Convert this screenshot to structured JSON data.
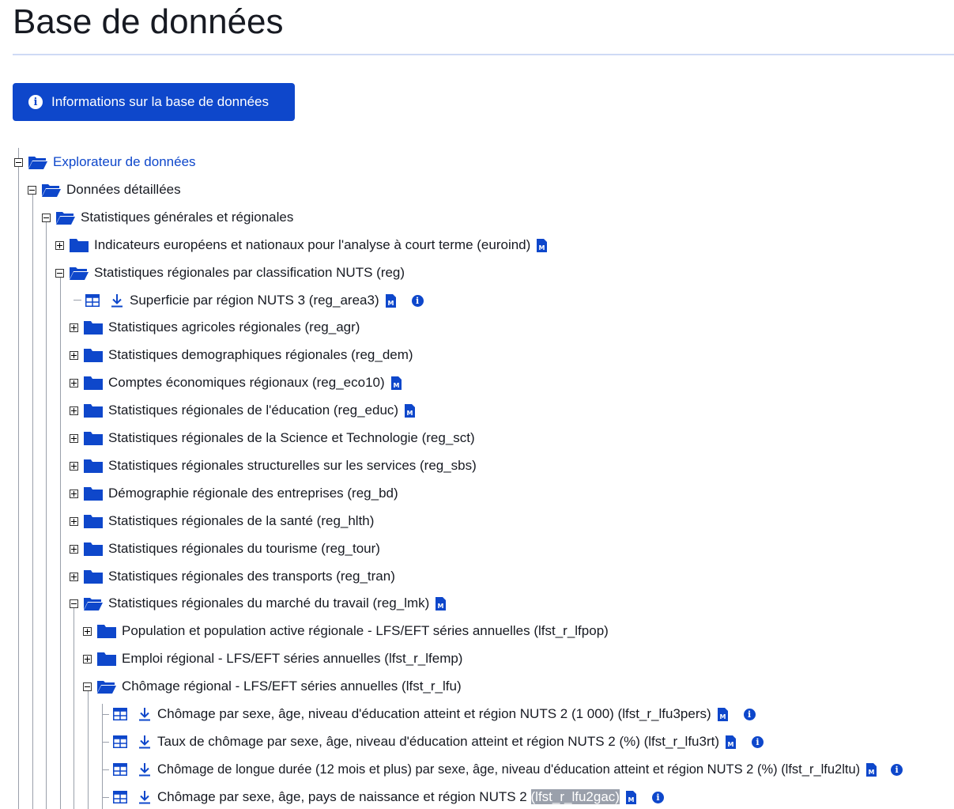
{
  "page": {
    "title": "Base de données"
  },
  "info_button": {
    "label": "Informations sur la base de données",
    "icon": "info-circle-icon"
  },
  "tree": {
    "root": "Explorateur de données",
    "detailed": "Données détaillées",
    "general": "Statistiques générales et régionales",
    "euroind": "Indicateurs européens et nationaux pour l'analyse à court terme (euroind)",
    "reg": "Statistiques régionales par classification NUTS (reg)",
    "reg_area3": {
      "label": "Superficie par région NUTS 3 ",
      "code": "(reg_area3)"
    },
    "reg_children": [
      {
        "label": "Statistiques agricoles régionales (reg_agr)",
        "meta": false
      },
      {
        "label": "Statistiques demographiques régionales (reg_dem)",
        "meta": false
      },
      {
        "label": "Comptes économiques régionaux (reg_eco10)",
        "meta": true
      },
      {
        "label": "Statistiques régionales de l'éducation (reg_educ)",
        "meta": true
      },
      {
        "label": "Statistiques régionales de la Science et Technologie (reg_sct)",
        "meta": false
      },
      {
        "label": "Statistiques régionales structurelles sur les services (reg_sbs)",
        "meta": false
      },
      {
        "label": "Démographie régionale des entreprises (reg_bd)",
        "meta": false
      },
      {
        "label": "Statistiques régionales de la santé (reg_hlth)",
        "meta": false
      },
      {
        "label": "Statistiques régionales du tourisme (reg_tour)",
        "meta": false
      },
      {
        "label": "Statistiques régionales des transports (reg_tran)",
        "meta": false
      }
    ],
    "reg_lmk": "Statistiques régionales du marché du travail (reg_lmk)",
    "lfpop": "Population et population active régionale - LFS/EFT séries annuelles (lfst_r_lfpop)",
    "lfemp": "Emploi régional - LFS/EFT séries annuelles (lfst_r_lfemp)",
    "lfu": "Chômage régional - LFS/EFT séries annuelles (lfst_r_lfu)",
    "lfu_datasets": [
      {
        "label": "Chômage par sexe, âge, niveau d'éducation atteint et région NUTS 2 (1 000) (lfst_r_lfu3pers)"
      },
      {
        "label": "Taux de chômage par sexe, âge, niveau d'éducation atteint et région NUTS 2 (%) (lfst_r_lfu3rt)"
      },
      {
        "label": "Chômage de longue durée (12 mois et plus) par sexe, âge, niveau d'éducation atteint et région NUTS 2 (%) (lfst_r_lfu2ltu)"
      },
      {
        "label": "Chômage par sexe, âge, pays de naissance et région NUTS 2 ",
        "code": "(lfst_r_lfu2gac)"
      }
    ]
  },
  "icons": {
    "folder_closed": "folder-icon",
    "folder_open": "folder-open-icon",
    "table": "table-icon",
    "download": "download-icon",
    "metadata": "metadata-file-icon",
    "info": "info-icon"
  },
  "colors": {
    "accent": "#0e47cb",
    "text": "#171a22",
    "tree_lines": "#9aa0ab",
    "selection": "#9aa0ab"
  }
}
